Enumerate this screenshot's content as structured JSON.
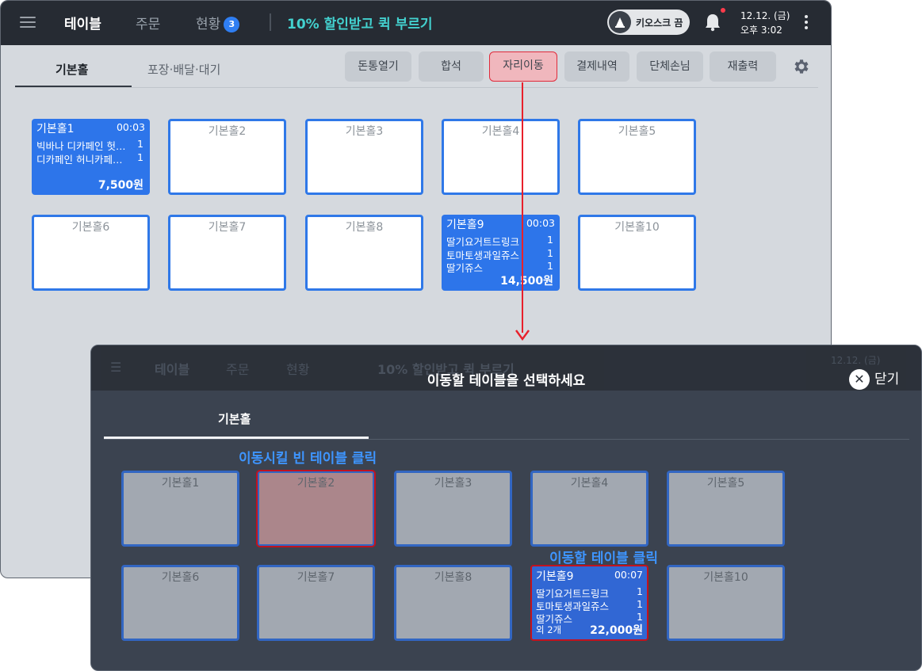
{
  "app": {
    "nav": [
      "테이블",
      "주문",
      "현황"
    ],
    "status_count": "3",
    "promo": "10% 할인받고 퀵 부르기",
    "kiosk_label": "키오스크 끔",
    "date": "12.12. (금)",
    "time": "오후 3:02"
  },
  "tabs": [
    "기본홀",
    "포장·배달·대기"
  ],
  "toolbar": [
    "돈통열기",
    "합석",
    "자리이동",
    "결제내역",
    "단체손님",
    "재출력"
  ],
  "tables": [
    {
      "name": "기본홀1",
      "time": "00:03",
      "items": [
        {
          "n": "빅바나 디카페인 헛…",
          "q": "1"
        },
        {
          "n": "디카페인 허니카페…",
          "q": "1"
        }
      ],
      "total": "7,500원"
    },
    {
      "name": "기본홀2"
    },
    {
      "name": "기본홀3"
    },
    {
      "name": "기본홀4"
    },
    {
      "name": "기본홀5"
    },
    {
      "name": "기본홀6"
    },
    {
      "name": "기본홀7"
    },
    {
      "name": "기본홀8"
    },
    {
      "name": "기본홀9",
      "time": "00:03",
      "items": [
        {
          "n": "딸기요거트드링크",
          "q": "1"
        },
        {
          "n": "토마토생과일쥬스",
          "q": "1"
        },
        {
          "n": "딸기쥬스",
          "q": "1"
        }
      ],
      "total": "14,500원"
    },
    {
      "name": "기본홀10"
    }
  ],
  "modal": {
    "title": "이동할 테이블을 선택하세요",
    "close": "닫기",
    "tab": "기본홀",
    "tables": [
      {
        "name": "기본홀1"
      },
      {
        "name": "기본홀2"
      },
      {
        "name": "기본홀3"
      },
      {
        "name": "기본홀4"
      },
      {
        "name": "기본홀5"
      },
      {
        "name": "기본홀6"
      },
      {
        "name": "기본홀7"
      },
      {
        "name": "기본홀8"
      },
      {
        "name": "기본홀9",
        "time": "00:07",
        "items": [
          {
            "n": "딸기요거트드링크",
            "q": "1"
          },
          {
            "n": "토마토생과일쥬스",
            "q": "1"
          },
          {
            "n": "딸기쥬스",
            "q": "1"
          }
        ],
        "extra": "외 2개",
        "total": "22,000원"
      },
      {
        "name": "기본홀10"
      }
    ]
  },
  "annotations": {
    "empty_hint": "이동시킬 빈 테이블 클릭",
    "target_hint": "이동할 테이블 클릭"
  },
  "colors": {
    "accent": "#2d75ea",
    "highlight": "#e02b3b",
    "promo": "#43d1cf",
    "annotation": "#3e95ff"
  }
}
